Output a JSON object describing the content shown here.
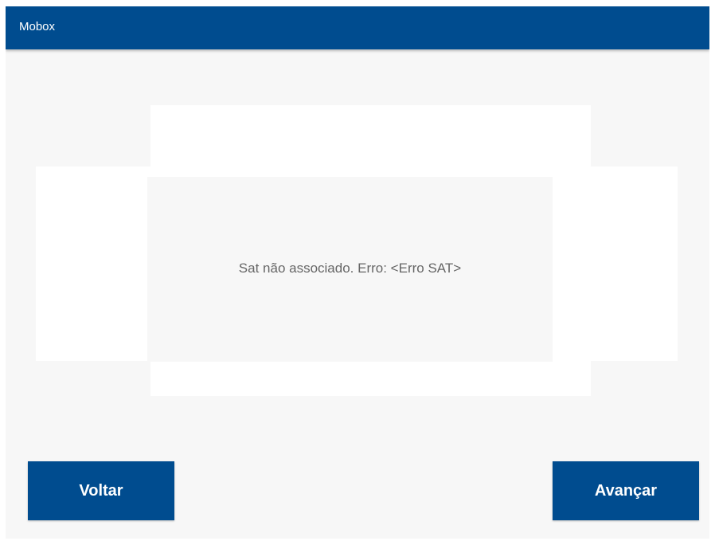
{
  "app": {
    "title": "Mobox"
  },
  "dialog": {
    "message": "Sat não associado. Erro: <Erro SAT>"
  },
  "buttons": {
    "back_label": "Voltar",
    "next_label": "Avançar"
  },
  "colors": {
    "primary": "#004c8f",
    "background": "#f7f7f7",
    "panel": "#ffffff",
    "message_text": "#666666"
  }
}
